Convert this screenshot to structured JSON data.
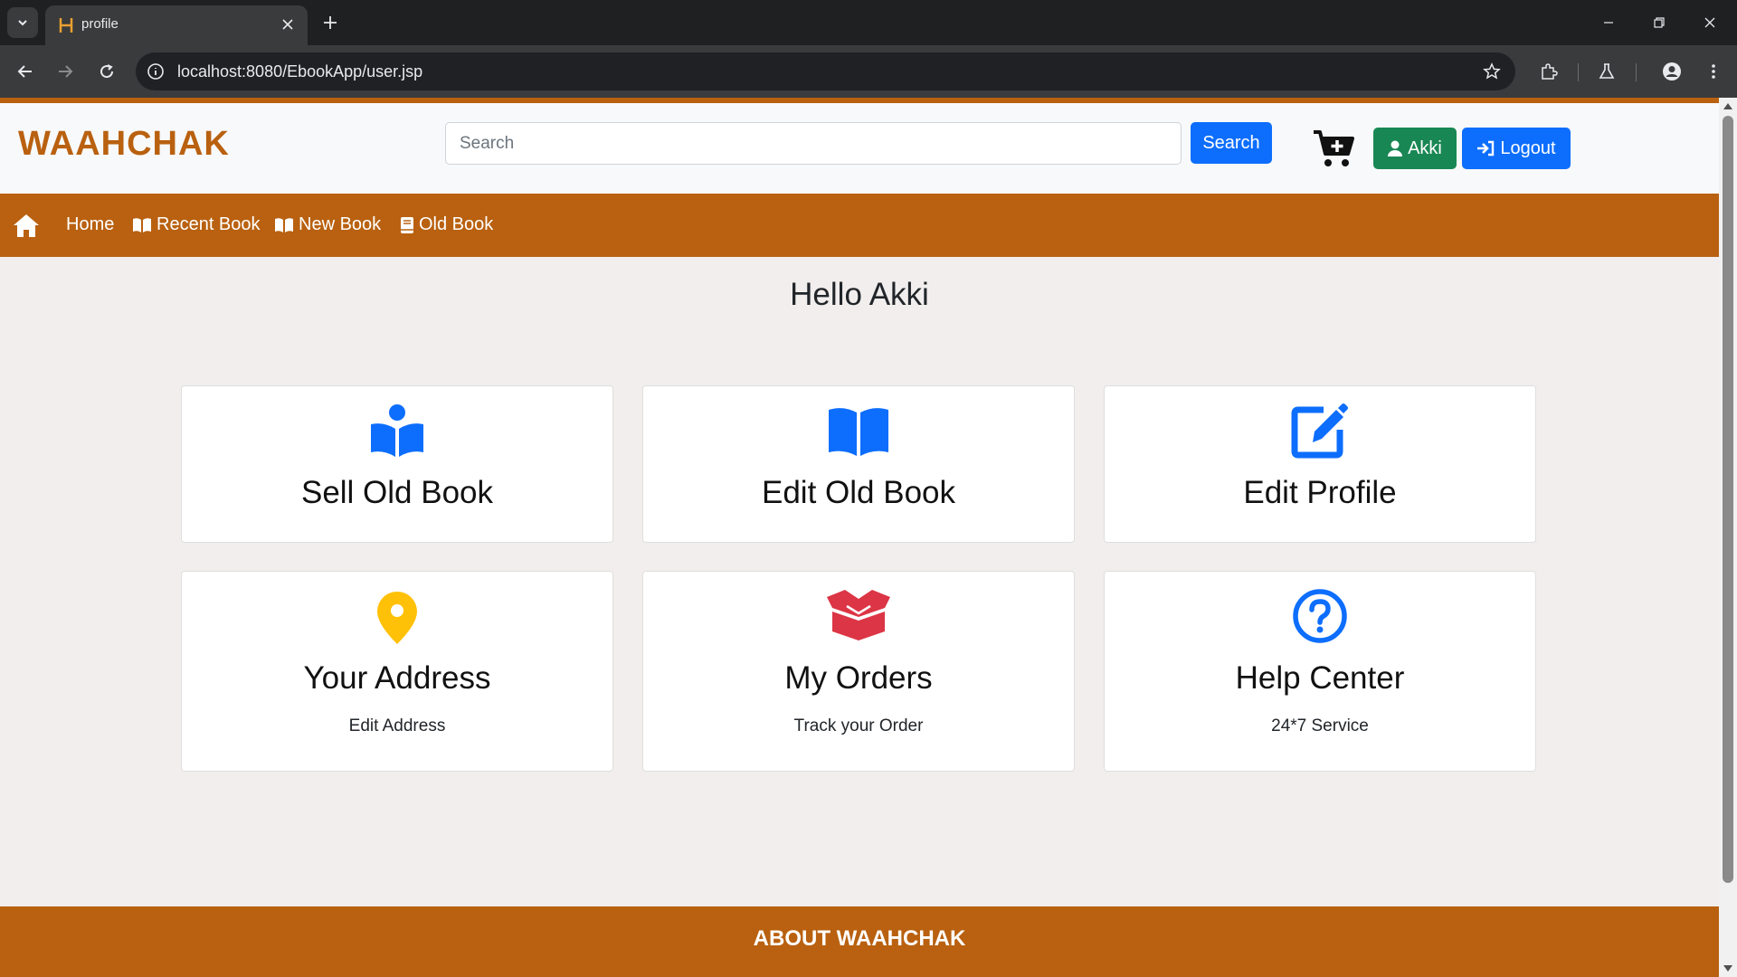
{
  "browser": {
    "tab_title": "profile",
    "url": "localhost:8080/EbookApp/user.jsp"
  },
  "header": {
    "logo_text_left": "WAA",
    "logo_text_mid": "H",
    "logo_text_right": "CHAK",
    "search_placeholder": "Search",
    "search_button": "Search",
    "user_button": "Akki",
    "logout_button": "Logout"
  },
  "nav": {
    "home": "Home",
    "recent": "Recent Book",
    "new": "New Book",
    "old": "Old Book"
  },
  "greeting": "Hello Akki",
  "cards": [
    {
      "title": "Sell Old Book",
      "subtitle": "",
      "icon": "book-reader-icon",
      "color": "#0d6efd"
    },
    {
      "title": "Edit Old Book",
      "subtitle": "",
      "icon": "open-book-icon",
      "color": "#0d6efd"
    },
    {
      "title": "Edit Profile",
      "subtitle": "",
      "icon": "edit-icon",
      "color": "#0d6efd"
    },
    {
      "title": "Your Address",
      "subtitle": "Edit Address",
      "icon": "map-marker-icon",
      "color": "#ffc107"
    },
    {
      "title": "My Orders",
      "subtitle": "Track your Order",
      "icon": "box-open-icon",
      "color": "#dc3545"
    },
    {
      "title": "Help Center",
      "subtitle": "24*7 Service",
      "icon": "question-circle-icon",
      "color": "#0d6efd"
    }
  ],
  "footer": {
    "title": "ABOUT WAAHCHAK"
  },
  "colors": {
    "brand": "#b96110",
    "primary": "#0d6efd",
    "success": "#198754"
  }
}
